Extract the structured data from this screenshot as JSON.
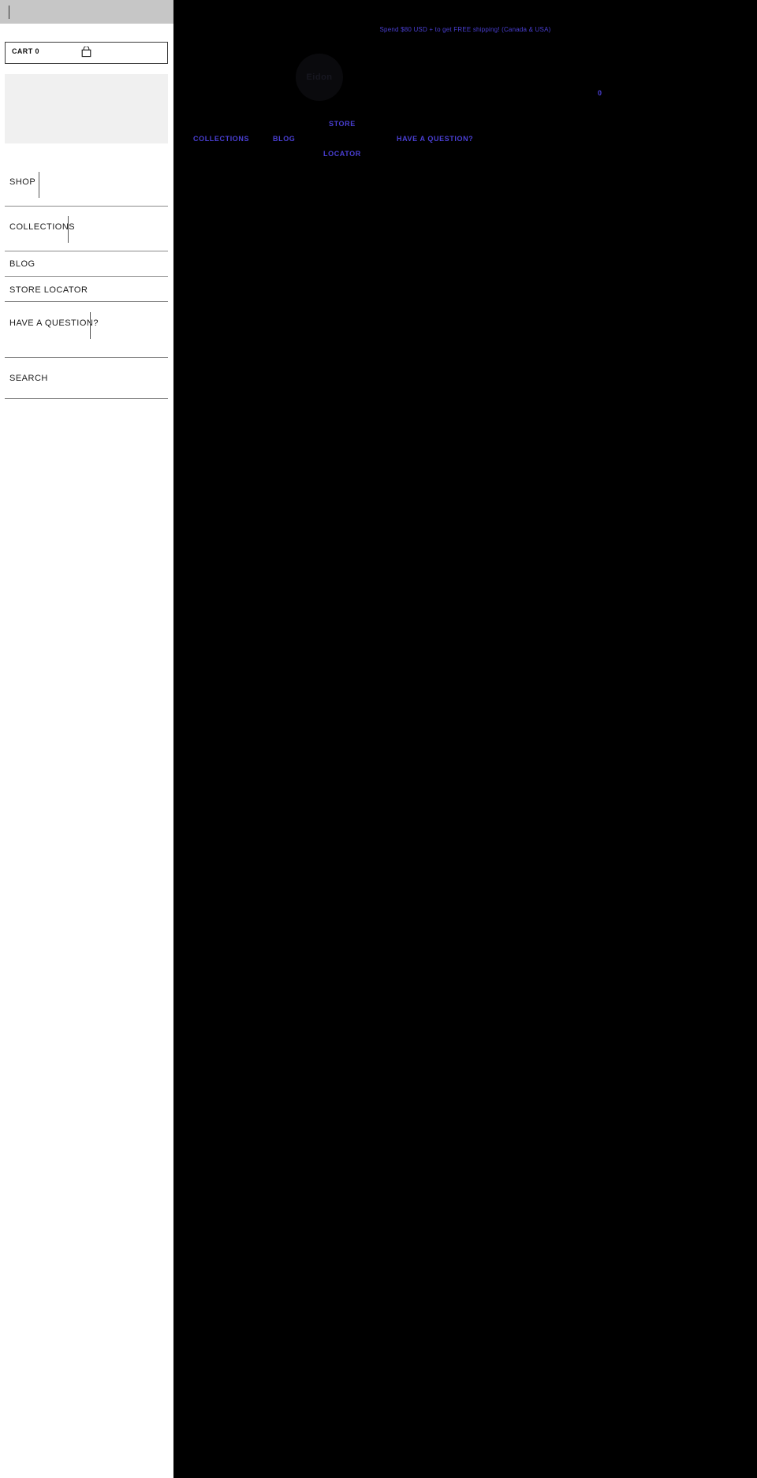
{
  "left_panel": {
    "topbar": {
      "caret": "|"
    },
    "cart": {
      "label": "CART 0",
      "icon": "shopping-bag-icon"
    },
    "placeholder_block": "",
    "menu_items": [
      {
        "label": "SHOP",
        "has_caret": true
      },
      {
        "label": "COLLECTIONS",
        "has_caret": true
      },
      {
        "label": "BLOG",
        "has_caret": false
      },
      {
        "label": "STORE LOCATOR",
        "has_caret": false
      },
      {
        "label": "HAVE A QUESTION?",
        "has_caret": true
      },
      {
        "label": "SEARCH",
        "has_caret": false
      }
    ]
  },
  "right_panel": {
    "promo_banner": "Spend $80 USD + to get FREE shipping! (Canada & USA)",
    "logo_text": "Eidon",
    "cart_count": "0",
    "nav_links": [
      {
        "label": "STORE"
      },
      {
        "label": "COLLECTIONS"
      },
      {
        "label": "BLOG"
      },
      {
        "label": "HAVE A QUESTION?"
      },
      {
        "label": "LOCATOR"
      }
    ]
  },
  "colors": {
    "accent_link": "#4a3fd4",
    "panel_dark": "#000000",
    "panel_light": "#ffffff",
    "topbar_gray": "#c6c6c6",
    "block_gray": "#f0f0f0"
  }
}
